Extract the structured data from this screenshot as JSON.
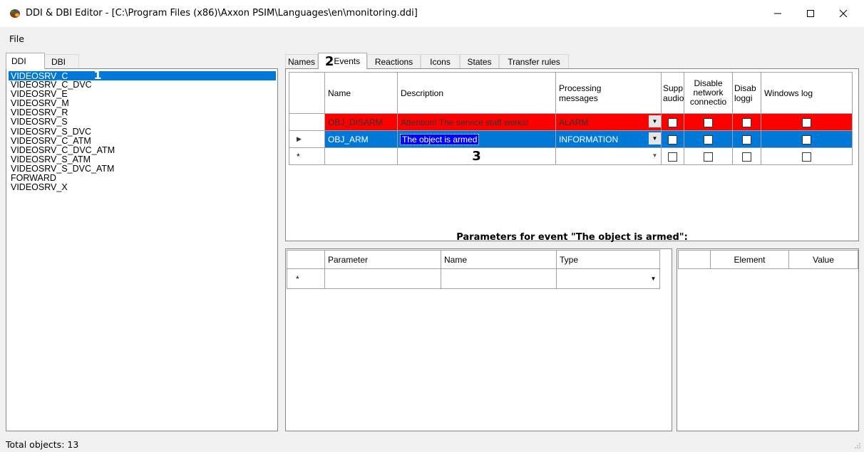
{
  "window": {
    "title": "DDI & DBI Editor - [C:\\Program Files (x86)\\Axxon PSIM\\Languages\\en\\monitoring.ddi]"
  },
  "menu": {
    "file": "File"
  },
  "left_tabs": {
    "ddi": "DDI",
    "dbi": "DBI"
  },
  "objects": [
    "VIDEOSRV_C",
    "VIDEOSRV_C_DVC",
    "VIDEOSRV_E",
    "VIDEOSRV_M",
    "VIDEOSRV_R",
    "VIDEOSRV_S",
    "VIDEOSRV_S_DVC",
    "VIDEOSRV_C_ATM",
    "VIDEOSRV_C_DVC_ATM",
    "VIDEOSRV_S_ATM",
    "VIDEOSRV_S_DVC_ATM",
    "FORWARD",
    "VIDEOSRV_X"
  ],
  "markers": {
    "one": "1",
    "two": "2",
    "three": "3"
  },
  "right_tabs": [
    "Names",
    "Events",
    "Reactions",
    "Icons",
    "States",
    "Transfer rules"
  ],
  "events_grid": {
    "headers": {
      "name": "Name",
      "description": "Description",
      "processing_l1": "Processing",
      "processing_l2": "messages",
      "supp_l1": "Supp",
      "supp_l2": "audio",
      "disnet_l1": "Disable",
      "disnet_l2": "network",
      "disnet_l3": "connectio",
      "dislog_l1": "Disab",
      "dislog_l2": "loggi",
      "winlog": "Windows log"
    },
    "rows": [
      {
        "name": "OBJ_DISARM",
        "description": "Attention! The service staff works!",
        "processing": "ALARM"
      },
      {
        "name": "OBJ_ARM",
        "description": "The object is armed",
        "processing": "INFORMATION"
      }
    ],
    "new_row_marker": "*",
    "current_row_marker": "▶"
  },
  "params_heading": "Parameters for event \"The object is armed\":",
  "params_grid": {
    "headers": {
      "parameter": "Parameter",
      "name": "Name",
      "type": "Type"
    },
    "new_row_marker": "*"
  },
  "elements_grid": {
    "headers": {
      "element": "Element",
      "value": "Value"
    }
  },
  "status": {
    "text": "Total objects: 13"
  },
  "colors": {
    "selection": "#0078d7",
    "alarm_row": "#ff0000",
    "edit_highlight": "#0000ff"
  }
}
